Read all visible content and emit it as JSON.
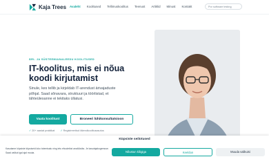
{
  "brand": {
    "name": "Kaja Trees",
    "accent": "#14a9a0"
  },
  "nav": {
    "items": [
      {
        "label": "Avaleht",
        "active": true
      },
      {
        "label": "Koolitused",
        "active": false
      },
      {
        "label": "Tellimuskoolitus",
        "active": false
      },
      {
        "label": "Teenust",
        "active": false
      },
      {
        "label": "Artiklid",
        "active": false
      },
      {
        "label": "Minust",
        "active": false
      },
      {
        "label": "Kontakt",
        "active": false
      }
    ],
    "search_label": "Por software testing"
  },
  "hero": {
    "eyebrow": "ÄRI- JA SÜSTEEMIANALEEDU KOOLITUSED",
    "headline": "IT-koolitus, mis ei nõua koodi kirjutamist",
    "intro": "Sinule, kes tellib ja kirjeldab IT-arendust ärivajaduste põhjal. Saad sõnavara, struktuuri ja töörlistad, et lähteülesanne ei tekitaks üllatusi.",
    "primary_button": "Vaata koolitust",
    "secondary_button": "Broneeri lühikonsultatsioon",
    "features": [
      "20+ aastat praktikat",
      "Registreeritud täiendkoolitusasutus"
    ]
  },
  "cookie": {
    "title": "Küpsiste seilotused",
    "text": "Kasutame küpsiste küpsiseid loko totemisalu ning ietu efcudeikst analüüsiks. Je kasutajakogemuse. Saad valikut igal ajal muuta.",
    "accept_label": "Nõustun kõigiga",
    "reject_label": "Keeldun",
    "settings_label": "Muuda valikuisi"
  }
}
